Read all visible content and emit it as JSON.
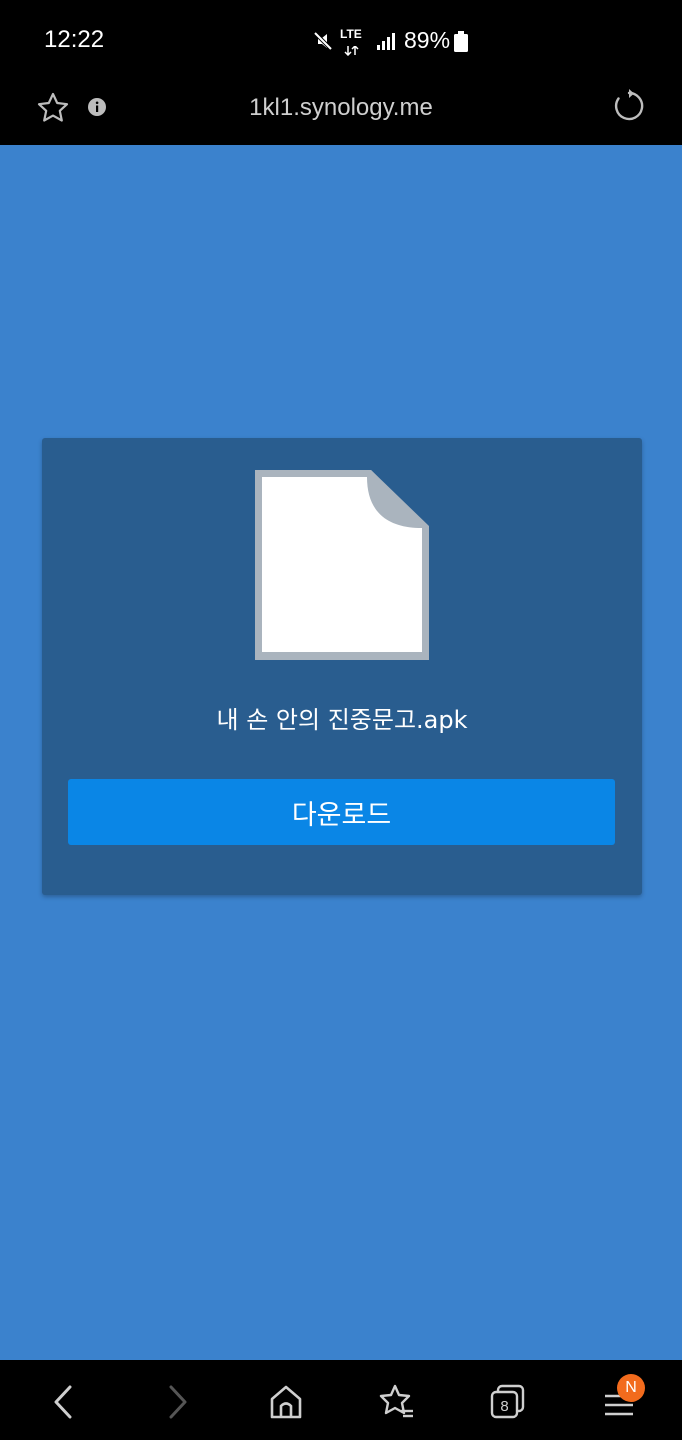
{
  "status_bar": {
    "time": "12:22",
    "network": "LTE",
    "battery": "89%"
  },
  "browser": {
    "url": "1kl1.synology.me"
  },
  "download_card": {
    "file_name": "내 손 안의 진중문고.apk",
    "button_label": "다운로드"
  },
  "bottom_nav": {
    "tabs_count": "8",
    "menu_badge": "N"
  },
  "colors": {
    "page_bg": "#3b82cd",
    "card_bg": "#295d8f",
    "button_bg": "#0a86e6",
    "badge": "#f26b1d"
  },
  "icons": [
    "star-icon",
    "info-icon",
    "refresh-icon",
    "back-icon",
    "forward-icon",
    "home-icon",
    "bookmarks-icon",
    "tabs-icon",
    "menu-icon",
    "file-icon"
  ]
}
